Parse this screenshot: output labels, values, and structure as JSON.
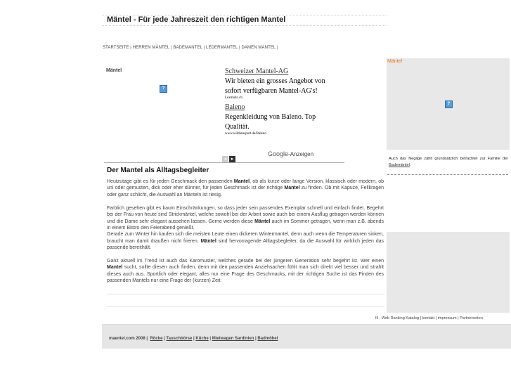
{
  "header": {
    "title": "Mäntel - Für jede Jahreszeit den richtigen Mantel"
  },
  "topnav": {
    "items": [
      "STARTSEITE",
      "HERREN MÄNTEL",
      "BADEMANTEL",
      "LEDERMANTEL",
      "DAMEN MANTEL"
    ]
  },
  "left": {
    "label": "Mäntel",
    "icon": "question-icon"
  },
  "ads": [
    {
      "title": "Schweizer Mantel-AG",
      "body": "Wir bieten ein grosses Angebot von sofort verfügbaren Mantel-AG's!",
      "url": "Lexmatic.ch"
    },
    {
      "title": "Baleno",
      "body": "Regenkleidung von Baleno. Top Qualität.",
      "url": "www.wildanssport.de/Baleno"
    }
  ],
  "ad_footer": {
    "prev": "◂",
    "next": "▸",
    "google": "Google",
    "label": "-Anzeigen"
  },
  "article": {
    "title": "Der Mantel als Alltagsbegleiter",
    "p1_a": "Heutzutage gibt es für jeden Geschmack den passenden ",
    "p1_kw1": "Mantel",
    "p1_b": ", ob als kurze oder lange Version, klassisch oder modern, ob uni oder gemustert, dick oder eher dünner, für jeden Geschmack ist der richtige ",
    "p1_kw2": "Mantel",
    "p1_c": " zu finden. Ob mit Kapuze, Fellkragen oder ganz schlicht, die Auswahl an Mänteln ist riesig.",
    "p2_a": "Farblich gesehen gibt es kaum Einschränkungen, so dass jeder sein passendes Exemplar schnell und einfach findet. Begehrt bei der Frau von heute sind Strickmäntel, welche sowohl bei der Arbeit sowie auch bei einem Ausflug getragen werden können und die Dame sehr elegant aussehen lassen. Gerne werden diese ",
    "p2_kw1": "Mäntel",
    "p2_b": " auch im Sommer getragen, wenn man z.B. abends in einem Bistro den Feierabend genießt.",
    "p2_c": "Gerade zum Winter hin kaufen sich die meisten Leute einen dickeren Wintermantel, denn auch wenn die Temperaturen sinken, braucht man damit draußen nicht frieren. ",
    "p2_kw2": "Mäntel",
    "p2_d": " sind hervorragende Alltagsbegleiter, da die Auswahl für wirklich jeden das passende bereithält.",
    "p3_a": "Ganz aktuell im Trend ist auch das Karomuster, welches gerade bei der jüngeren Generation sehr begehrt ist. Wer einen ",
    "p3_kw1": "Mantel",
    "p3_b": " sucht, sollte diesen auch finden, denn mit den passenden Anziehsachen fühlt man sich direkt viel besser und strahlt dieses auch aus. Sportlich oder elegant, alles nur eine Frage des Geschmacks, mit der richtigen Suche ist das Finden des passenden Mantels nur eine Frage der (kurzen) Zeit."
  },
  "sidebar": {
    "heading": "Mäntel",
    "icon": "question-icon",
    "text_a": "Auch das Negligé zählt grundsätzlich betrachtet zur Familie der ",
    "text_link": "Bademäntel",
    "text_b": "."
  },
  "bottom_links": {
    "items": [
      "Ill - Web Ranking Katalog",
      "kontakt",
      "impressum",
      "Partnerseiten"
    ]
  },
  "footer": {
    "prefix": "maentel.com 2008 |",
    "links": [
      "Röcke",
      "Tauschbörse",
      "Küche",
      "Mietwagen Sardinien",
      "Badmöbel"
    ]
  }
}
